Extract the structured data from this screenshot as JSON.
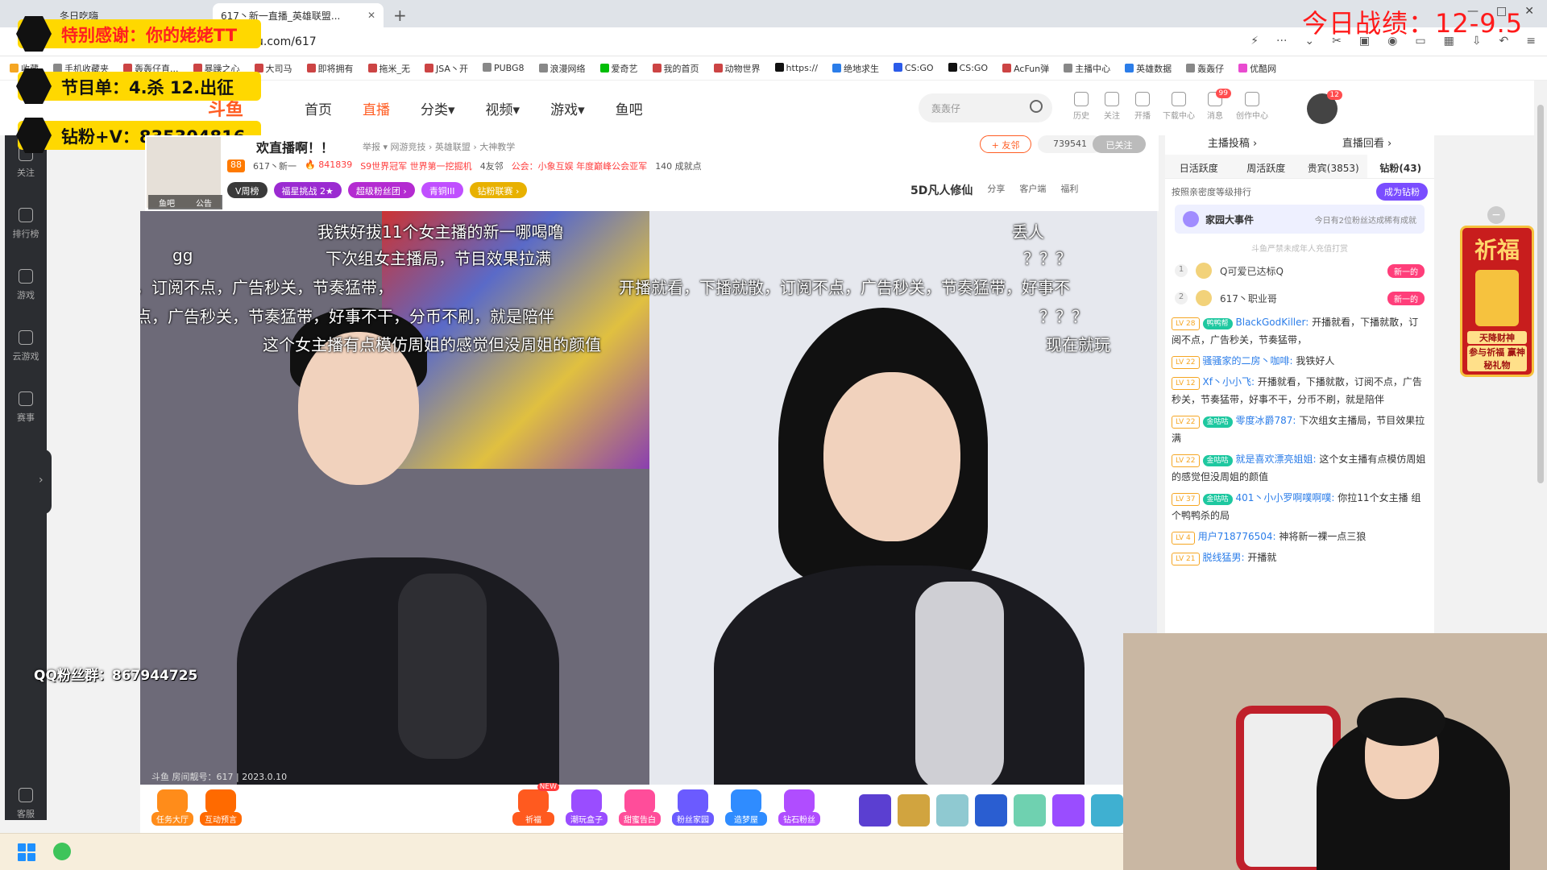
{
  "browser": {
    "tabs": [
      {
        "label": "冬日吃嗨"
      },
      {
        "label": "617丶新一直播_英雄联盟..."
      }
    ],
    "url": "u.com/617",
    "bookmarks": [
      "收藏",
      "手机收藏夹",
      "轰轰仔直...",
      "暴躁之心",
      "大司马",
      "即将拥有",
      "拖米_无",
      "JSA丶开",
      "PUBG8",
      "浪漫网络",
      "爱奇艺",
      "我的首页",
      "动物世界",
      "https://",
      "绝地求生",
      "CS:GO",
      "CS:GO",
      "AcFun弹",
      "主播中心",
      "英雄数据",
      "轰轰仔",
      "优酷网"
    ]
  },
  "overlay": {
    "banner_thanks": "特别感谢：你的姥姥TT",
    "banner_program": "节目单：4.杀 12.出征",
    "banner_fans": "钻粉+V：835304816",
    "record": "今日战绩：12-9.5",
    "qq_group": "QQ粉丝群：867944725"
  },
  "site": {
    "logo": "斗鱼",
    "nav": [
      "首页",
      "直播",
      "分类",
      "视频",
      "游戏",
      "鱼吧"
    ],
    "search_placeholder": "轰轰仔",
    "header_icons": [
      {
        "label": "历史",
        "name": "history-icon"
      },
      {
        "label": "关注",
        "name": "heart-icon"
      },
      {
        "label": "开播",
        "name": "broadcast-icon"
      },
      {
        "label": "下载中心",
        "name": "download-icon"
      },
      {
        "label": "消息",
        "name": "bell-icon",
        "badge": "99"
      },
      {
        "label": "创作中心",
        "name": "bulb-icon"
      }
    ],
    "avatar_badge": "12"
  },
  "leftnav": [
    {
      "label": "关注",
      "name": "heart-icon"
    },
    {
      "label": "排行榜",
      "name": "ranking-icon"
    },
    {
      "label": "游戏",
      "name": "gamepad-icon"
    },
    {
      "label": "云游戏",
      "name": "cloud-game-icon"
    },
    {
      "label": "赛事",
      "name": "trophy-icon"
    },
    {
      "label": "客服",
      "name": "headset-icon"
    }
  ],
  "room": {
    "avatar_tags": [
      "鱼吧",
      "公告"
    ],
    "title": "欢直播啊！！",
    "meta": "举报 ▾   网游竞技 › 英雄联盟 › 大神教学",
    "follow_label": "+ 友邻",
    "follow_count": "739541",
    "followed_label": "已关注",
    "level": "88",
    "name": "617丶新一",
    "heat": "841839",
    "honor": "S9世界冠军 世界第一挖掘机",
    "friends": "4友邻",
    "guild": "公会：小象互娱  年度巅峰公会亚军",
    "points": "140 成就点",
    "pills": [
      {
        "label": "V周榜",
        "color": "#3a3a3a"
      },
      {
        "label": "福星挑战  2★",
        "color": "#9b2bd1"
      },
      {
        "label": "超级粉丝团 ›",
        "color": "#b42bd1"
      },
      {
        "label": "青铜III",
        "color": "#c04fff"
      },
      {
        "label": "钻粉联赛 ›",
        "color": "#e8b100"
      }
    ],
    "fan_logo": "5D凡人修仙",
    "actions": [
      "分享",
      "客户端",
      "福利"
    ]
  },
  "video": {
    "danmu": [
      "我铁好拔11个女主播的新一哪喝噜",
      "丢人",
      "gg",
      "下次组女主播局，节目效果拉满",
      "？？？",
      "，订阅不点，广告秒关，节奏猛带，",
      "开播就看，下播就散，订阅不点，广告秒关，节奏猛带，好事不",
      "点，广告秒关，节奏猛带，好事不干，分币不刷，就是陪伴",
      "？？？",
      "这个女主播有点模仿周姐的感觉但没周姐的颜值",
      "现在就玩"
    ],
    "watermark": "斗鱼 房间靓号：617 | 2023.0.10"
  },
  "gifts": [
    {
      "label": "任务大厅",
      "color": "#ff8c1a"
    },
    {
      "label": "互动预言",
      "color": "#ff6a00"
    },
    {
      "label": "祈福",
      "color": "#ff5a1f",
      "tag": "NEW"
    },
    {
      "label": "潮玩盒子",
      "color": "#9a4dff"
    },
    {
      "label": "甜蜜告白",
      "color": "#ff4d9a"
    },
    {
      "label": "粉丝家园",
      "color": "#6b5bff"
    },
    {
      "label": "造梦屋",
      "color": "#2f8cff"
    },
    {
      "label": "钻石粉丝",
      "color": "#b04dff"
    }
  ],
  "sidebar": {
    "top": [
      "主播投稿 ›",
      "直播回看 ›"
    ],
    "tabs": [
      "日活跃度",
      "周活跃度",
      "贵宾(3853)",
      "钻粉(43)"
    ],
    "sort_label": "按照亲密度等级排行",
    "become_label": "成为钻粉",
    "family_title": "家园大事件",
    "family_desc": "今日有2位粉丝达成稀有成就",
    "notice": "斗鱼严禁未成年人充值打赏",
    "ranks": [
      {
        "n": "1",
        "name": "Q可爱已达标Q",
        "badge": "新一的"
      },
      {
        "n": "2",
        "name": "617丶职业哥",
        "badge": "新一的"
      }
    ],
    "chat": [
      {
        "lv": "LV 28",
        "fan": "鸭鸭帮",
        "name": "BlackGodKiller:",
        "text": "开播就看，下播就散，订阅不点，广告秒关，节奏猛带，"
      },
      {
        "lv": "LV 22",
        "fan": "",
        "name": "骚骚家的二房丶咖啡:",
        "text": "我铁好人"
      },
      {
        "lv": "LV 12",
        "fan": "",
        "name": "Xf丶小小飞:",
        "text": "开播就看，下播就散，订阅不点，广告秒关，节奏猛带，好事不干，分币不刷，就是陪伴"
      },
      {
        "lv": "LV 22",
        "fan": "金咕咕",
        "name": "零度冰爵787:",
        "text": "下次组女主播局，节目效果拉满"
      },
      {
        "lv": "LV 22",
        "fan": "金咕咕",
        "name": "就是喜欢漂亮姐姐:",
        "text": "这个女主播有点模仿周姐的感觉但没周姐的颜值"
      },
      {
        "lv": "LV 37",
        "fan": "金咕咕",
        "name": "401丶小小罗啊噗啊噗:",
        "text": "你拉11个女主播 组个鸭鸭杀的局"
      },
      {
        "lv": "LV 4",
        "fan": "",
        "name": "用户718776504:",
        "text": "神将新一裸一点三狼"
      },
      {
        "lv": "LV 21",
        "fan": "",
        "name": "脱线猛男:",
        "text": "开播就"
      }
    ]
  },
  "qifu": {
    "title": "祈福",
    "line1": "天降财神",
    "line2": "参与祈福 赢神秘礼物"
  }
}
